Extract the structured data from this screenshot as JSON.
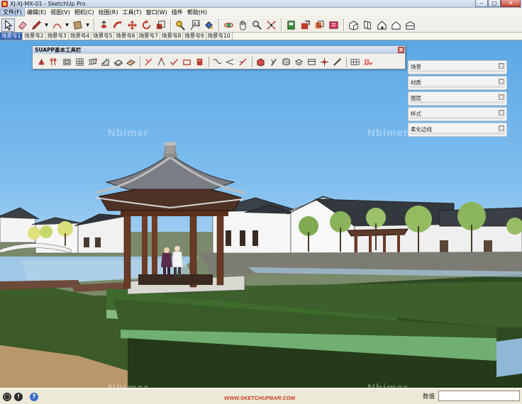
{
  "window": {
    "title": "XJ-XJ-MX-01 - SketchUp Pro",
    "controls": [
      "–",
      "□",
      "✕"
    ]
  },
  "menu": [
    "文件(F)",
    "编辑(E)",
    "视图(V)",
    "相机(C)",
    "绘图(R)",
    "工具(T)",
    "窗口(W)",
    "插件",
    "帮助(H)"
  ],
  "scene_tabs": [
    "场景号1",
    "场景号2",
    "场景号3",
    "场景号4",
    "场景号5",
    "场景号6",
    "场景号7",
    "场景号8",
    "场景号9",
    "场景号10"
  ],
  "suapp": {
    "title": "SUAPP基本工具栏",
    "close": "x"
  },
  "trays": [
    {
      "label": "场景",
      "button": "□"
    },
    {
      "label": "材质",
      "button": "□"
    },
    {
      "label": "图层",
      "button": "□"
    },
    {
      "label": "样式",
      "button": "□"
    },
    {
      "label": "柔化边线",
      "button": "□"
    }
  ],
  "watermarks": [
    "Nbimer",
    "Nbimer",
    "Nbimer",
    "Nbimer"
  ],
  "status": {
    "url": "WWW.SKETCHUPBAR.COM",
    "measure_label": "数值",
    "measure_value": ""
  },
  "colors": {
    "accent": "#2f62b5",
    "sky_top": "#5ba8e6",
    "grass": "#3e5f2a",
    "wood": "#6a3a25",
    "roof": "#5f6670"
  }
}
